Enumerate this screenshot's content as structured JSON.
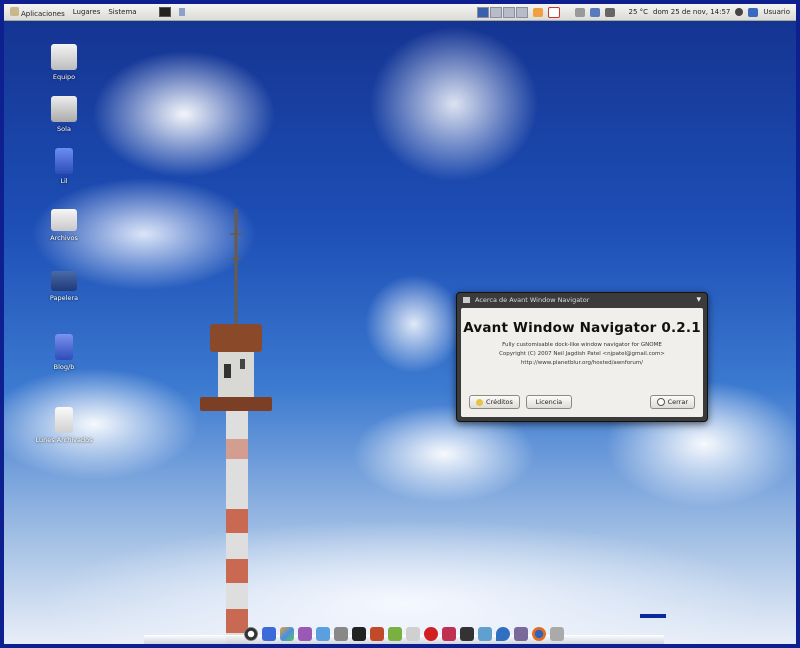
{
  "panel": {
    "menu": [
      "Aplicaciones",
      "Lugares",
      "Sistema"
    ],
    "clock": "dom 25 de nov, 14:57",
    "user": "Usuario",
    "temp": "25 °C"
  },
  "desktop_icons": [
    {
      "label": "Equipo",
      "icon": "computer-icon"
    },
    {
      "label": "Sola",
      "icon": "drive-icon"
    },
    {
      "label": "Lil",
      "icon": "folder-icon"
    },
    {
      "label": "Archivos",
      "icon": "folder-icon"
    },
    {
      "label": "Papelera",
      "icon": "trash-icon"
    },
    {
      "label": "Blog/b",
      "icon": "folder-icon"
    },
    {
      "label": "Lunes Archivados",
      "icon": "document-icon"
    }
  ],
  "dialog": {
    "title": "Acerca de Avant Window Navigator",
    "app_name": "Avant Window Navigator 0.2.1",
    "description": "Fully customisable dock-like window navigator for GNOME",
    "copyright": "Copyright (C) 2007 Neil Jagdish Patel <njpatel@gmail.com>",
    "url": "http://www.planetblur.org/hosted/awnforum/",
    "credits_label": "Créditos",
    "license_label": "Licencia",
    "close_label": "Cerrar"
  },
  "dock": {
    "items": [
      "power-icon",
      "box-icon",
      "paint-icon",
      "puzzle-icon",
      "pencil-icon",
      "terminal-icon",
      "screen-icon",
      "bird-icon",
      "gear-icon",
      "chart-icon",
      "redball-icon",
      "app-icon",
      "terminal2-icon",
      "music-icon",
      "drop-icon",
      "pidgin-icon",
      "firefox-icon",
      "tools-icon"
    ]
  },
  "colors": {
    "border": "#0e1f8f",
    "sky_top": "#14328f",
    "dialog_frame": "#3b3b3b",
    "dialog_body": "#f0efec"
  }
}
